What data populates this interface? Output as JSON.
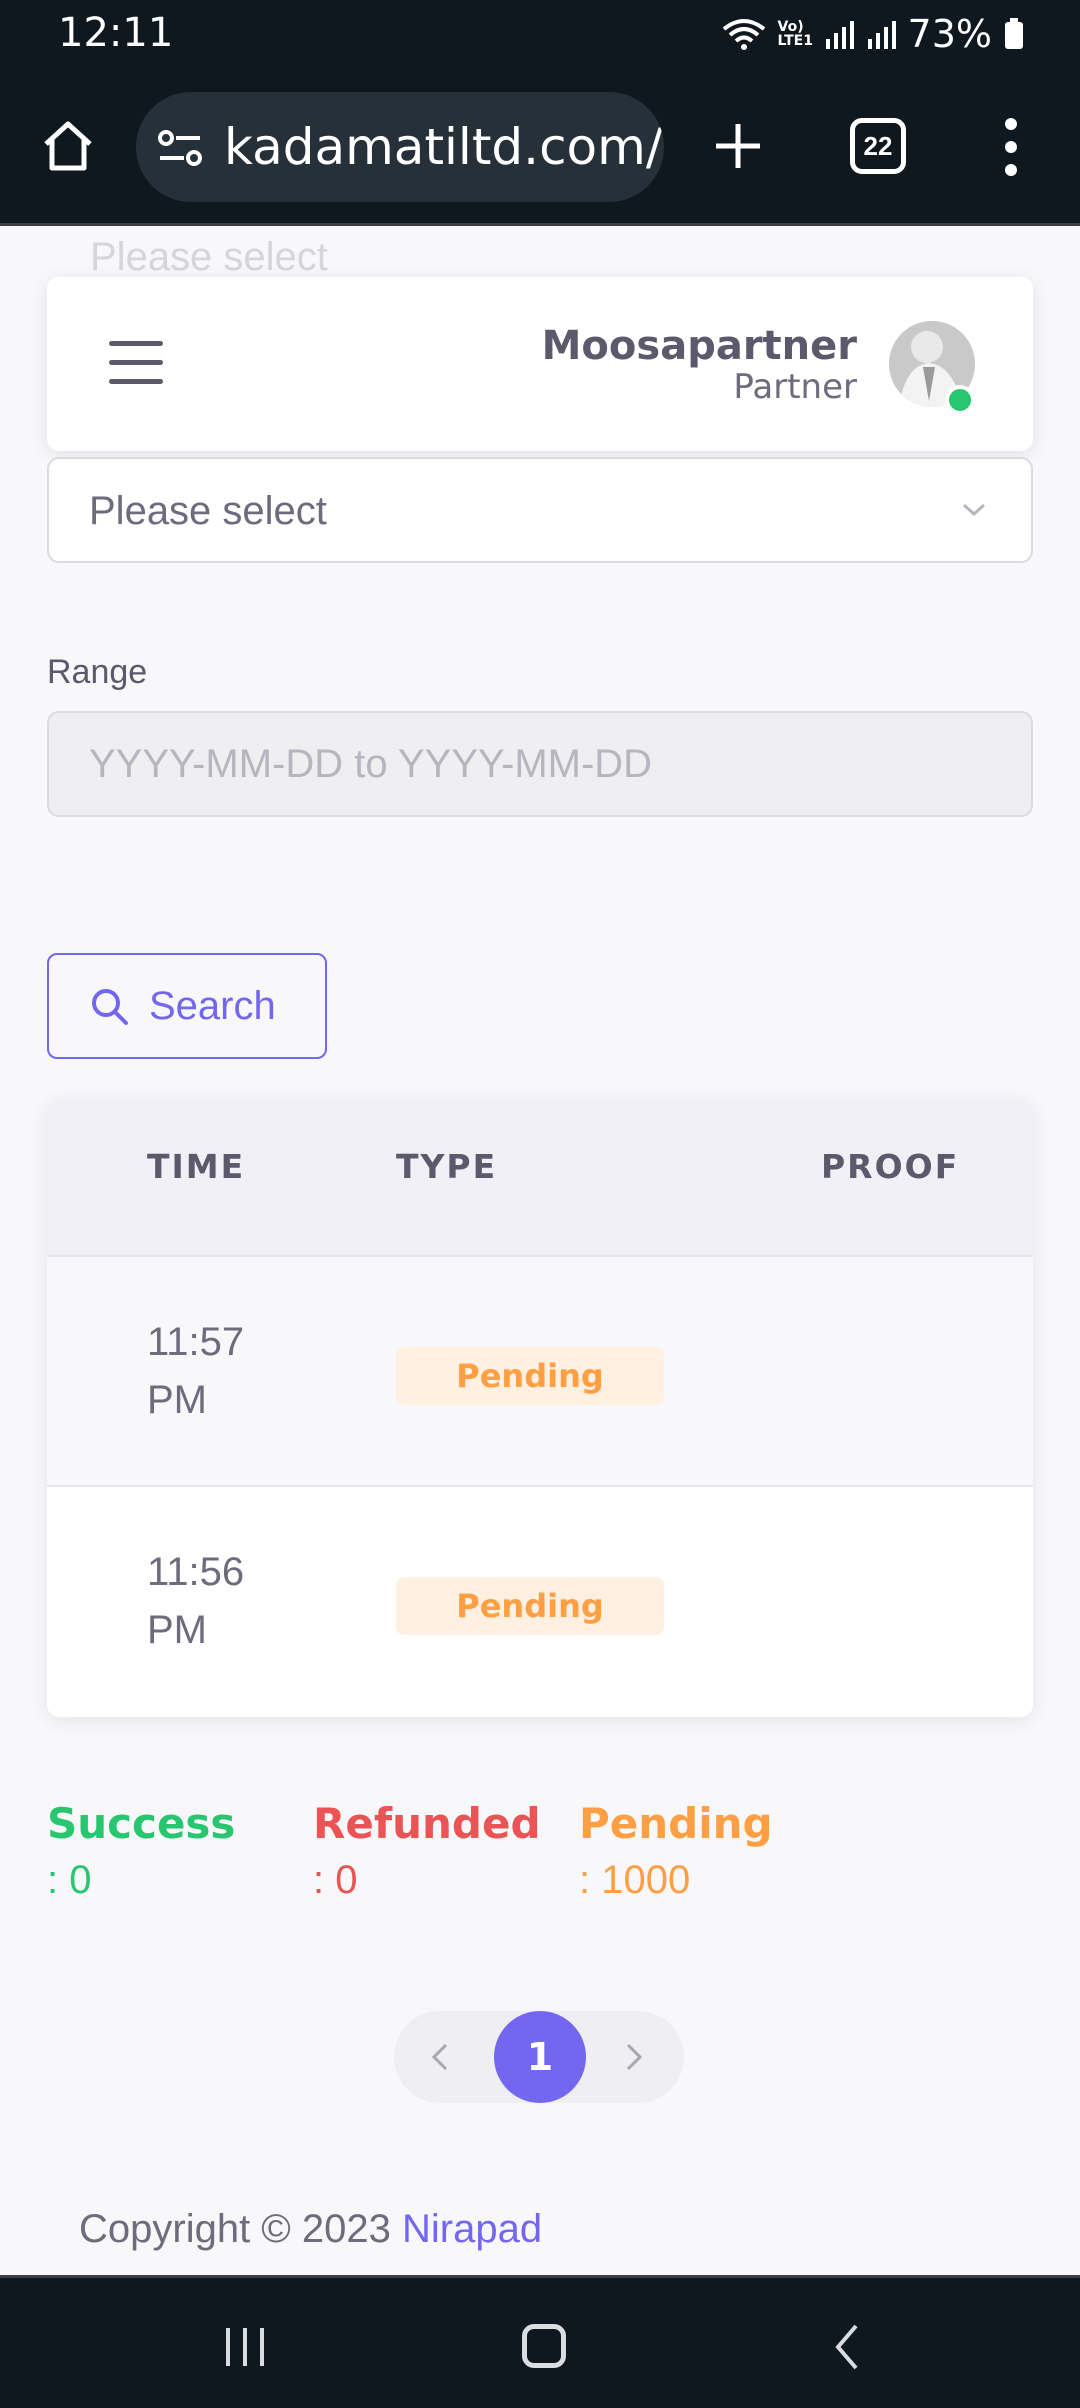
{
  "status_bar": {
    "time": "12:11",
    "battery": "73%",
    "network_label": "Vo) LTE1"
  },
  "browser": {
    "url": "kadamatiltd.com/d",
    "tab_count": "22"
  },
  "header": {
    "ghost_placeholder": "Please select",
    "user_name": "Moosapartner",
    "user_role": "Partner",
    "online_color": "#28c76f"
  },
  "filters": {
    "select_placeholder": "Please select",
    "range_label": "Range",
    "range_placeholder": "YYYY-MM-DD to YYYY-MM-DD",
    "search_label": "Search"
  },
  "table": {
    "columns": [
      "TIME",
      "TYPE",
      "PROOF"
    ],
    "rows": [
      {
        "time": "11:57 PM",
        "type": "Pending",
        "proof": ""
      },
      {
        "time": "11:56 PM",
        "type": "Pending",
        "proof": ""
      }
    ]
  },
  "stats": {
    "success": {
      "label": "Success",
      "value": ": 0",
      "color": "#28c76f"
    },
    "refunded": {
      "label": "Refunded",
      "value": ": 0",
      "color": "#ea5455"
    },
    "pending": {
      "label": "Pending",
      "value": ": 1000",
      "color": "#ff9f43"
    }
  },
  "pagination": {
    "current": "1"
  },
  "footer": {
    "copyright": "Copyright © 2023",
    "brand": "Nirapad"
  },
  "colors": {
    "primary": "#7367f0",
    "warning": "#ff9f43"
  }
}
